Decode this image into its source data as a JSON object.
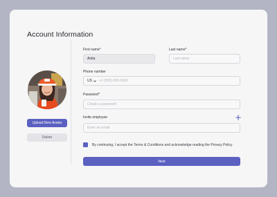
{
  "header": {
    "title": "Account Information"
  },
  "avatar_panel": {
    "upload_label": "Upload New Avatar",
    "delete_label": "Delete"
  },
  "form": {
    "first_name": {
      "label": "First name*",
      "value": "Anita"
    },
    "last_name": {
      "label": "Last name*",
      "placeholder": "Last name"
    },
    "phone": {
      "label": "Phone number",
      "country": "US",
      "placeholder": "+1 (555) 000-0000"
    },
    "password": {
      "label": "Password*",
      "placeholder": "Create a password"
    },
    "invite": {
      "label": "Invite employee",
      "placeholder": "Enter an email"
    },
    "terms": {
      "text": "By continuing, I accept the Terms & Conditions and acknowledge reading the Privacy Policy",
      "checked": true
    },
    "next_label": "Next"
  },
  "icons": {
    "plus": "plus-icon",
    "check": "check-icon",
    "chevron": "chevron-down-icon"
  },
  "colors": {
    "background": "#b3b5c4",
    "card": "#f6f6f7",
    "accent": "#5b60c1"
  }
}
